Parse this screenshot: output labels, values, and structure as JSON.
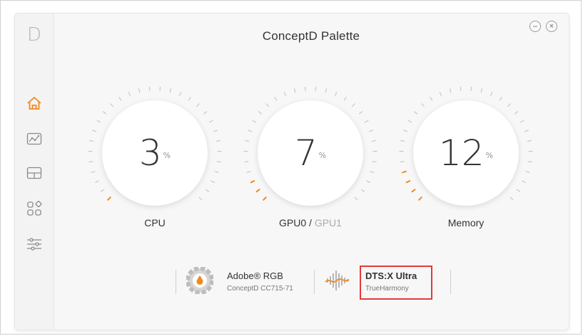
{
  "app": {
    "title": "ConceptD Palette",
    "logo_letter": "D",
    "minimize_label": "–",
    "close_label": "×"
  },
  "sidebar": {
    "items": [
      {
        "name": "home",
        "icon": "home-icon",
        "active": true
      },
      {
        "name": "performance",
        "icon": "graph-icon",
        "active": false
      },
      {
        "name": "layout",
        "icon": "layout-icon",
        "active": false
      },
      {
        "name": "apps",
        "icon": "apps-icon",
        "active": false
      },
      {
        "name": "settings",
        "icon": "sliders-icon",
        "active": false
      }
    ]
  },
  "gauges": {
    "cpu": {
      "value": "3",
      "unit": "%",
      "label": "CPU"
    },
    "gpu": {
      "value": "7",
      "unit": "%",
      "label_active": "GPU0",
      "separator": " / ",
      "label_inactive": "GPU1"
    },
    "memory": {
      "value": "12",
      "unit": "%",
      "label": "Memory"
    }
  },
  "info_bar": {
    "color_profile": {
      "title": "Adobe® RGB",
      "subtitle": "ConceptD CC715-71"
    },
    "audio": {
      "title": "DTS:X Ultra",
      "subtitle": "TrueHarmony"
    }
  },
  "colors": {
    "accent": "#f08a1c",
    "tick": "#c8c8c8",
    "highlight": "#e33a3a"
  }
}
